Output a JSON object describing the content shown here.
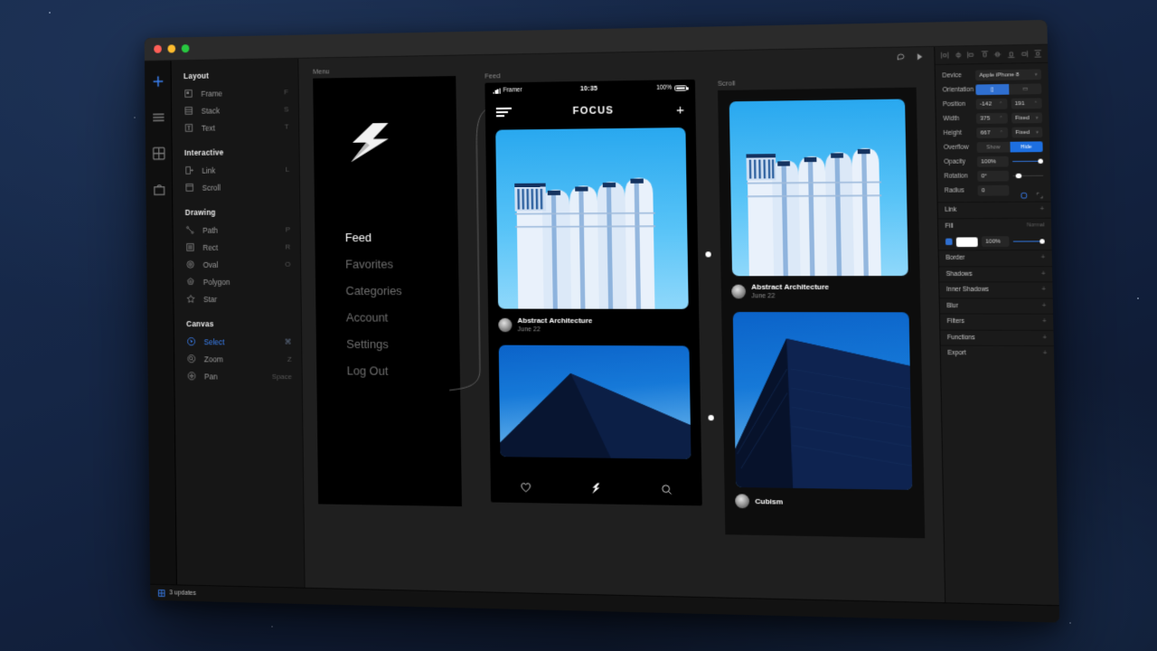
{
  "window": {
    "traffic_lights": [
      "close",
      "minimize",
      "maximize"
    ],
    "statusbar": {
      "updates_label": "3 updates",
      "icon": "grid-icon"
    },
    "topright": {
      "comment_icon": "comment-icon",
      "preview_icon": "play-icon"
    }
  },
  "rail": {
    "items": [
      {
        "name": "add",
        "icon": "plus-icon",
        "active": true
      },
      {
        "name": "layers",
        "icon": "layers-icon",
        "active": false
      },
      {
        "name": "components",
        "icon": "grid-icon",
        "active": false
      },
      {
        "name": "assets",
        "icon": "bag-icon",
        "active": false
      }
    ]
  },
  "tools": {
    "groups": [
      {
        "title": "Layout",
        "items": [
          {
            "label": "Frame",
            "key": "F",
            "icon": "frame-icon"
          },
          {
            "label": "Stack",
            "key": "S",
            "icon": "stack-icon"
          },
          {
            "label": "Text",
            "key": "T",
            "icon": "text-icon"
          }
        ]
      },
      {
        "title": "Interactive",
        "items": [
          {
            "label": "Link",
            "key": "L",
            "icon": "link-icon"
          },
          {
            "label": "Scroll",
            "key": "",
            "icon": "scroll-icon"
          }
        ]
      },
      {
        "title": "Drawing",
        "items": [
          {
            "label": "Path",
            "key": "P",
            "icon": "path-icon"
          },
          {
            "label": "Rect",
            "key": "R",
            "icon": "rect-icon"
          },
          {
            "label": "Oval",
            "key": "O",
            "icon": "oval-icon"
          },
          {
            "label": "Polygon",
            "key": "",
            "icon": "polygon-icon"
          },
          {
            "label": "Star",
            "key": "",
            "icon": "star-icon"
          }
        ]
      },
      {
        "title": "Canvas",
        "items": [
          {
            "label": "Select",
            "key": "⌘",
            "icon": "cursor-icon",
            "selected": true
          },
          {
            "label": "Zoom",
            "key": "Z",
            "icon": "zoom-icon"
          },
          {
            "label": "Pan",
            "key": "Space",
            "icon": "pan-icon"
          }
        ]
      }
    ]
  },
  "canvas": {
    "frames": {
      "menu": {
        "label": "Menu",
        "logo_icon": "bolt-logo-icon",
        "nav": [
          {
            "label": "Feed",
            "active": true
          },
          {
            "label": "Favorites",
            "active": false
          },
          {
            "label": "Categories",
            "active": false
          },
          {
            "label": "Account",
            "active": false
          },
          {
            "label": "Settings",
            "active": false
          },
          {
            "label": "Log Out",
            "active": false
          }
        ]
      },
      "phone": {
        "label": "Feed",
        "status": {
          "carrier": "Framer",
          "time": "10:35",
          "battery_pct": "100%"
        },
        "navbar": {
          "title": "FOCUS",
          "menu_icon": "hamburger-icon",
          "add_icon": "plus-icon"
        },
        "cards": [
          {
            "title": "Abstract Architecture",
            "date": "June 22",
            "image": "white-arched-building"
          },
          {
            "title": "",
            "date": "",
            "image": "dark-angular-building"
          }
        ],
        "tabbar": [
          {
            "icon": "heart-icon",
            "active": false
          },
          {
            "icon": "bolt-icon",
            "active": true
          },
          {
            "icon": "search-icon",
            "active": false
          }
        ]
      },
      "scroll": {
        "label": "Scroll",
        "cards": [
          {
            "title": "Abstract Architecture",
            "date": "June 22",
            "image": "white-arched-building"
          },
          {
            "title": "Cubism",
            "date": "",
            "image": "dark-angular-building"
          }
        ]
      }
    }
  },
  "props": {
    "rows": [
      {
        "label": "Device",
        "type": "select",
        "value": "Apple iPhone 8"
      },
      {
        "label": "Orientation",
        "type": "segment",
        "options": [
          "portrait",
          "landscape"
        ],
        "selected": 0
      },
      {
        "label": "Position",
        "type": "pair",
        "x": "-142",
        "y": "191"
      },
      {
        "label": "Width",
        "type": "value_unit",
        "value": "375",
        "unit": "Fixed"
      },
      {
        "label": "Height",
        "type": "value_unit",
        "value": "667",
        "unit": "Fixed"
      },
      {
        "label": "Overflow",
        "type": "segment",
        "options": [
          "Show",
          "Hide"
        ],
        "selected": 1
      },
      {
        "label": "Opacity",
        "type": "value_slider",
        "value": "100%",
        "pct": 100
      },
      {
        "label": "Rotation",
        "type": "value_slider",
        "value": "0°",
        "pct": 12
      },
      {
        "label": "Radius",
        "type": "value_icons",
        "value": "0"
      }
    ],
    "sections": [
      {
        "label": "Link",
        "action": "+"
      },
      {
        "label": "Fill",
        "action": "+",
        "note": "Normal"
      },
      {
        "label": "Border",
        "action": "+"
      },
      {
        "label": "Shadows",
        "action": "+"
      },
      {
        "label": "Inner Shadows",
        "action": "+"
      },
      {
        "label": "Blur",
        "action": "+"
      },
      {
        "label": "Filters",
        "action": "+"
      },
      {
        "label": "Functions",
        "action": "+"
      },
      {
        "label": "Export",
        "action": "+"
      }
    ],
    "fill": {
      "color": "#ffffff",
      "opacity": "100%",
      "enabled": true
    }
  },
  "colors": {
    "accent": "#3b82f6",
    "panel": "#1a1a1a",
    "canvas": "#1f1f1f",
    "sky": "#29a8ef",
    "deep_blue": "#0b63c9"
  }
}
